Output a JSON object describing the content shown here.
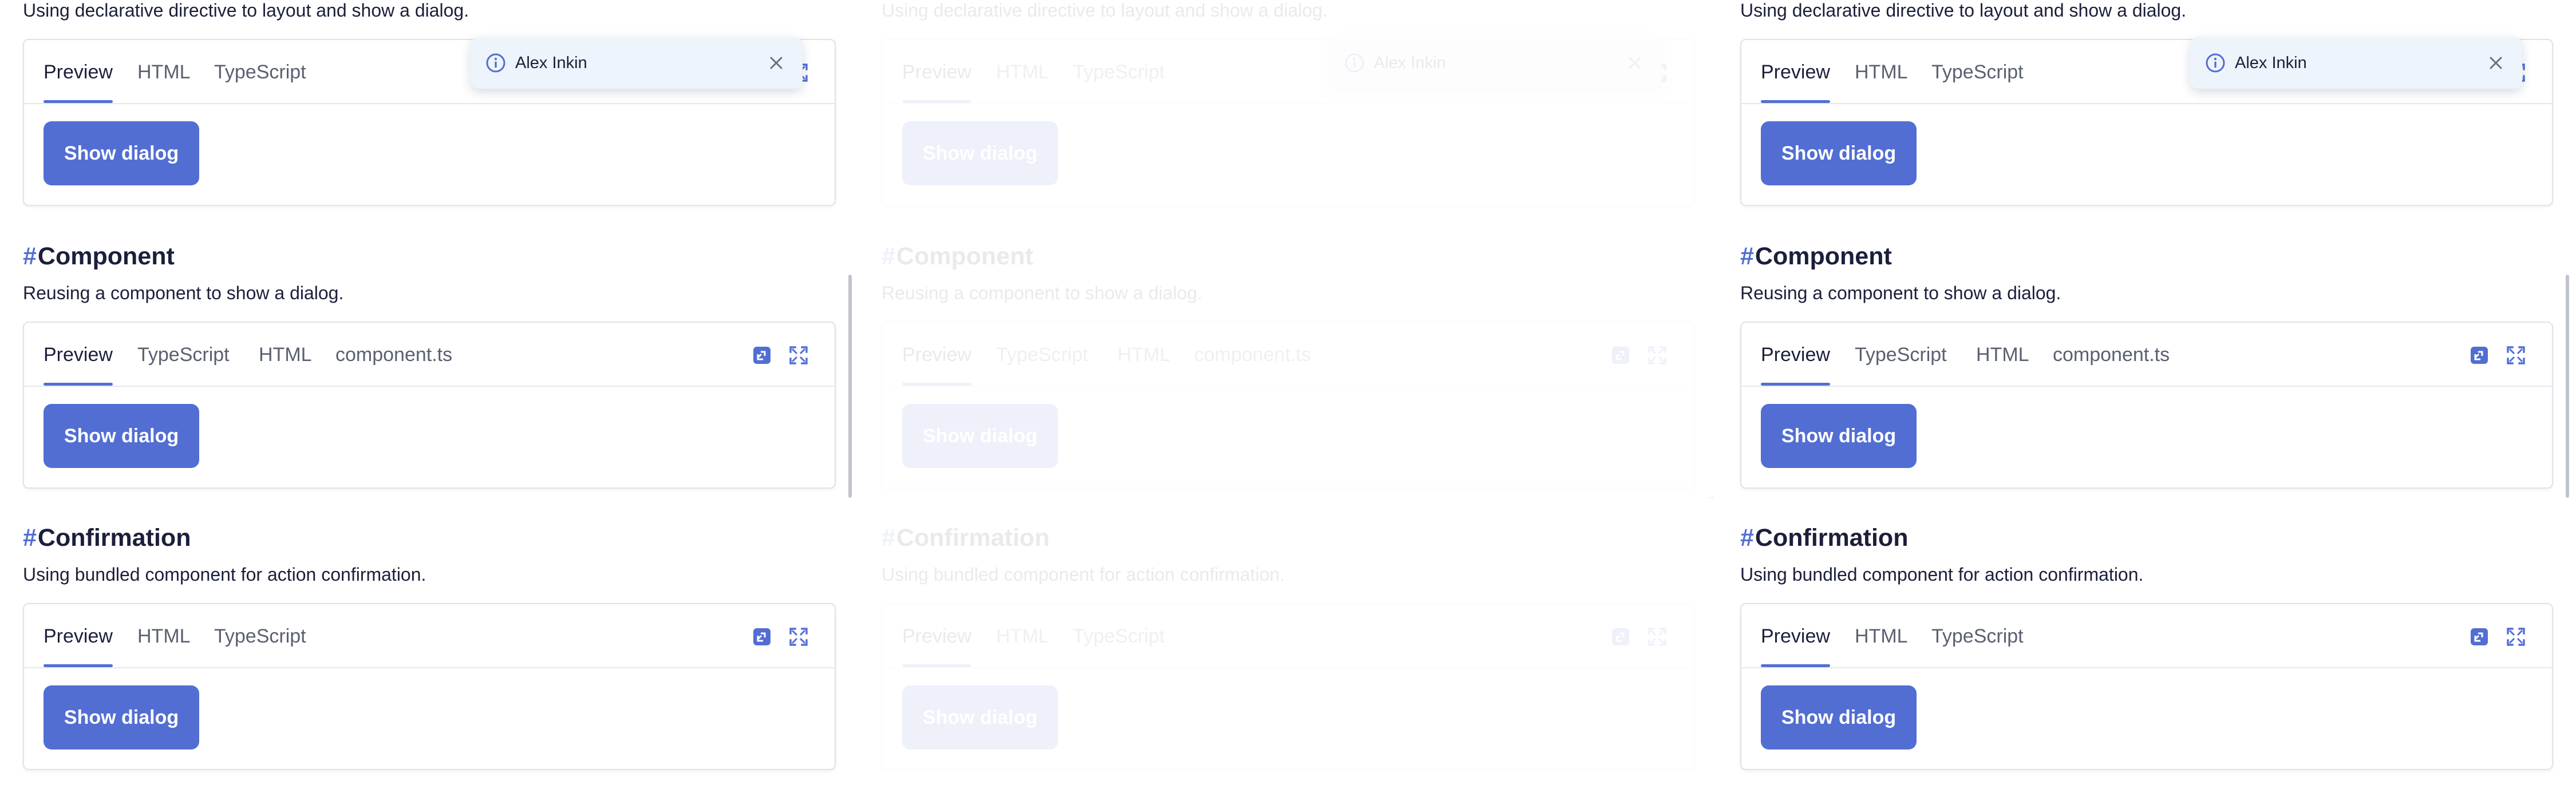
{
  "intro": {
    "text": "Using declarative directive to layout and show a dialog."
  },
  "notification": {
    "text": "Alex Inkin",
    "icon": "info-icon"
  },
  "tool_icons": {
    "copy": "copy-link-icon",
    "expand": "fullscreen-expand-icon"
  },
  "sections": [
    {
      "tabs": [
        "Preview",
        "HTML",
        "TypeScript"
      ],
      "button_label": "Show dialog"
    },
    {
      "hash": "#",
      "title": "Component",
      "description": "Reusing a component to show a dialog.",
      "tabs": [
        "Preview",
        "TypeScript",
        "HTML",
        "component.ts"
      ],
      "button_label": "Show dialog"
    },
    {
      "hash": "#",
      "title": "Confirmation",
      "description": "Using bundled component for action confirmation.",
      "tabs": [
        "Preview",
        "HTML",
        "TypeScript"
      ],
      "button_label": "Show dialog"
    }
  ],
  "colors": {
    "accent": "#526ed3",
    "text": "#1b1f3b",
    "muted": "#5a6070",
    "notification_bg": "#edf4fb"
  }
}
